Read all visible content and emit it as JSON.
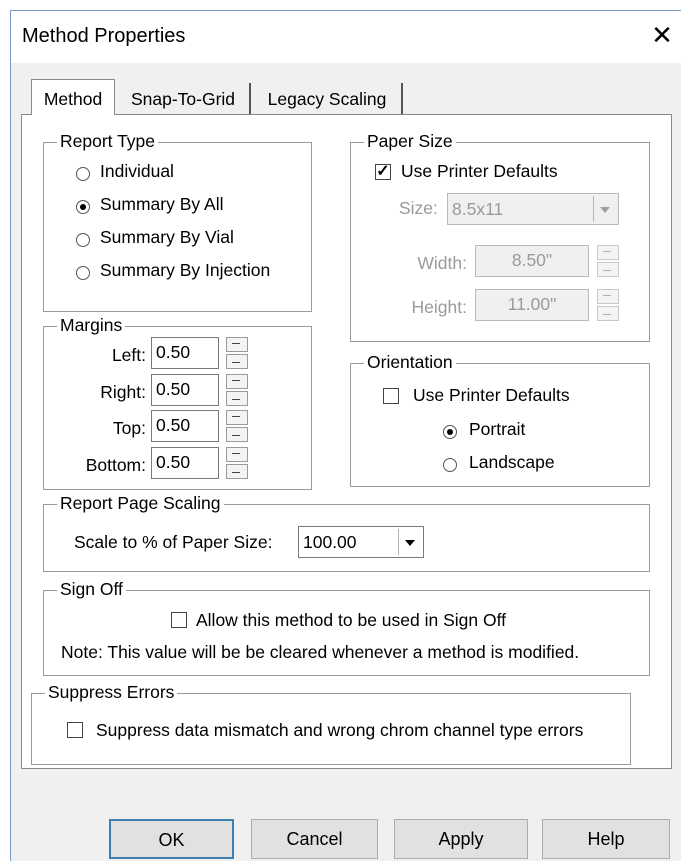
{
  "window": {
    "title": "Method Properties",
    "close_icon": "close-icon"
  },
  "tabs": [
    {
      "label": "Method",
      "active": true
    },
    {
      "label": "Snap-To-Grid",
      "active": false
    },
    {
      "label": "Legacy Scaling",
      "active": false
    }
  ],
  "report_type": {
    "legend": "Report Type",
    "options": [
      "Individual",
      "Summary By All",
      "Summary By Vial",
      "Summary By Injection"
    ],
    "selected": "Summary By All"
  },
  "paper_size": {
    "legend": "Paper Size",
    "use_printer_defaults_label": "Use Printer Defaults",
    "use_printer_defaults_checked": true,
    "size_label": "Size:",
    "size_value": "8.5x11",
    "width_label": "Width:",
    "width_value": "8.50\"",
    "height_label": "Height:",
    "height_value": "11.00\""
  },
  "margins": {
    "legend": "Margins",
    "left_label": "Left:",
    "left_value": "0.50",
    "right_label": "Right:",
    "right_value": "0.50",
    "top_label": "Top:",
    "top_value": "0.50",
    "bottom_label": "Bottom:",
    "bottom_value": "0.50"
  },
  "orientation": {
    "legend": "Orientation",
    "use_printer_defaults_label": "Use Printer Defaults",
    "use_printer_defaults_checked": false,
    "portrait_label": "Portrait",
    "landscape_label": "Landscape",
    "selected": "Portrait"
  },
  "report_page_scaling": {
    "legend": "Report Page Scaling",
    "scale_label": "Scale to % of Paper Size:",
    "scale_value": "100.00"
  },
  "sign_off": {
    "legend": "Sign Off",
    "allow_label": "Allow this method to be used in Sign Off",
    "allow_checked": false,
    "note": "Note: This value will be be cleared whenever a method is modified."
  },
  "suppress_errors": {
    "legend": "Suppress Errors",
    "suppress_label": "Suppress data mismatch and wrong chrom channel type errors",
    "suppress_checked": false
  },
  "buttons": {
    "ok": "OK",
    "cancel": "Cancel",
    "apply": "Apply",
    "help": "Help"
  }
}
